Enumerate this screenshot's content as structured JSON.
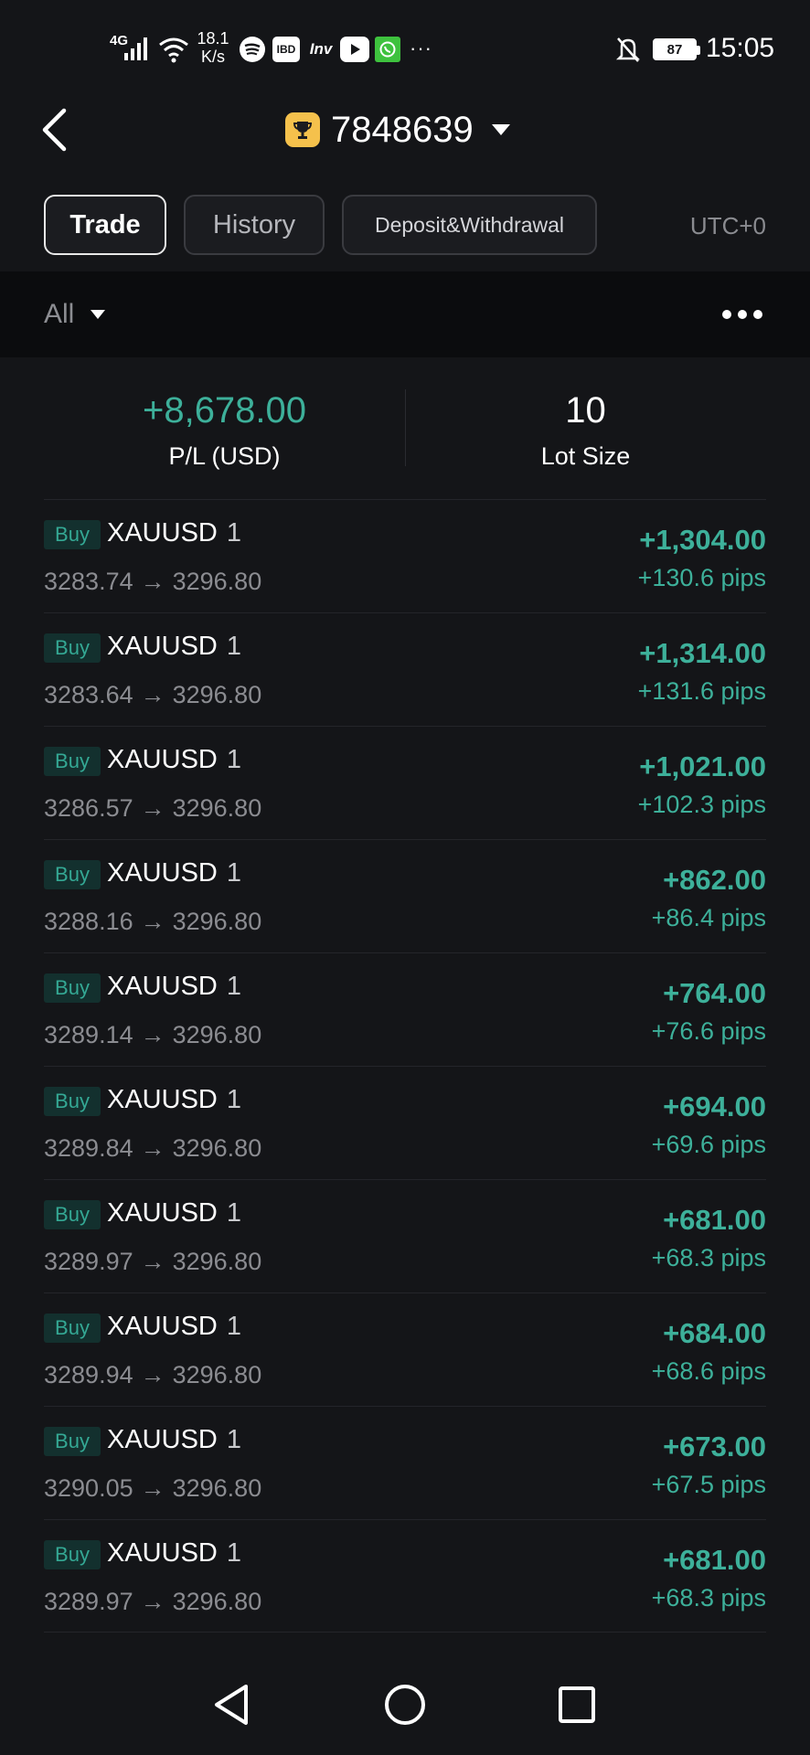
{
  "status_bar": {
    "network": "4G",
    "speed_value": "18.1",
    "speed_unit": "K/s",
    "ibd": "IBD",
    "inv": "Inv",
    "more": "···",
    "battery": "87",
    "time": "15:05"
  },
  "header": {
    "account_number": "7848639"
  },
  "tabs": [
    {
      "label": "Trade",
      "active": true
    },
    {
      "label": "History",
      "active": false
    },
    {
      "label": "Deposit&Withdrawal",
      "active": false
    }
  ],
  "timezone": "UTC+0",
  "filter": {
    "selected": "All"
  },
  "summary": {
    "pl_value": "+8,678.00",
    "pl_label": "P/L (USD)",
    "lot_value": "10",
    "lot_label": "Lot Size"
  },
  "colors": {
    "profit": "#3db09a",
    "badge_bg": "#13302e",
    "trophy": "#f5c14c",
    "background": "#141518"
  },
  "orders": [
    {
      "side": "Buy",
      "symbol": "XAUUSD",
      "lot": "1",
      "open": "3283.74",
      "close": "3296.80",
      "profit": "+1,304.00",
      "pips": "+130.6 pips"
    },
    {
      "side": "Buy",
      "symbol": "XAUUSD",
      "lot": "1",
      "open": "3283.64",
      "close": "3296.80",
      "profit": "+1,314.00",
      "pips": "+131.6 pips"
    },
    {
      "side": "Buy",
      "symbol": "XAUUSD",
      "lot": "1",
      "open": "3286.57",
      "close": "3296.80",
      "profit": "+1,021.00",
      "pips": "+102.3 pips"
    },
    {
      "side": "Buy",
      "symbol": "XAUUSD",
      "lot": "1",
      "open": "3288.16",
      "close": "3296.80",
      "profit": "+862.00",
      "pips": "+86.4 pips"
    },
    {
      "side": "Buy",
      "symbol": "XAUUSD",
      "lot": "1",
      "open": "3289.14",
      "close": "3296.80",
      "profit": "+764.00",
      "pips": "+76.6 pips"
    },
    {
      "side": "Buy",
      "symbol": "XAUUSD",
      "lot": "1",
      "open": "3289.84",
      "close": "3296.80",
      "profit": "+694.00",
      "pips": "+69.6 pips"
    },
    {
      "side": "Buy",
      "symbol": "XAUUSD",
      "lot": "1",
      "open": "3289.97",
      "close": "3296.80",
      "profit": "+681.00",
      "pips": "+68.3 pips"
    },
    {
      "side": "Buy",
      "symbol": "XAUUSD",
      "lot": "1",
      "open": "3289.94",
      "close": "3296.80",
      "profit": "+684.00",
      "pips": "+68.6 pips"
    },
    {
      "side": "Buy",
      "symbol": "XAUUSD",
      "lot": "1",
      "open": "3290.05",
      "close": "3296.80",
      "profit": "+673.00",
      "pips": "+67.5 pips"
    },
    {
      "side": "Buy",
      "symbol": "XAUUSD",
      "lot": "1",
      "open": "3289.97",
      "close": "3296.80",
      "profit": "+681.00",
      "pips": "+68.3 pips"
    }
  ],
  "icons": {
    "back": "chevron-left-icon",
    "trophy": "trophy-icon",
    "caret": "caret-down-icon",
    "more": "more-dots-icon",
    "arrow": "→",
    "nav_back": "triangle-back-icon",
    "nav_home": "circle-home-icon",
    "nav_recents": "square-recents-icon"
  }
}
